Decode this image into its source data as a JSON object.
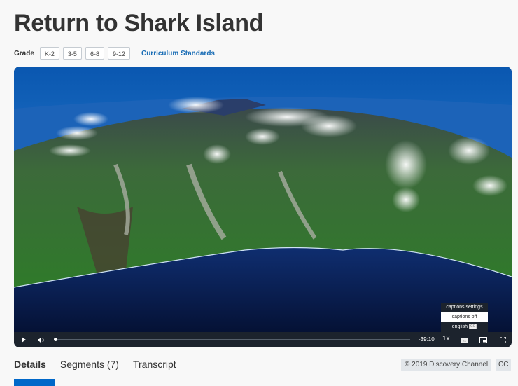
{
  "page": {
    "title": "Return to Shark Island",
    "grade_label": "Grade",
    "grades": [
      "K-2",
      "3-5",
      "6-8",
      "9-12"
    ],
    "curriculum_link": "Curriculum Standards"
  },
  "video": {
    "scene_description": "aerial view of volcanic island with clouds and deep blue ocean",
    "progress_fraction": 0.0,
    "time_remaining": "-39:10",
    "playback_speed": "1x",
    "captions_menu": {
      "header": "captions settings",
      "items": [
        "captions off",
        "english"
      ],
      "selected": "captions off",
      "cc_badge": "CC"
    },
    "icons": {
      "play": "play-icon",
      "volume": "volume-icon",
      "captions": "closed-captions-icon",
      "pip": "picture-in-picture-icon",
      "fullscreen": "fullscreen-icon"
    }
  },
  "tabs": [
    {
      "label": "Details",
      "active": true
    },
    {
      "label": "Segments (7)",
      "active": false
    },
    {
      "label": "Transcript",
      "active": false
    }
  ],
  "credit": "© 2019 Discovery Channel",
  "cc_tag": "CC",
  "colors": {
    "accent": "#0068c9",
    "link": "#1a6db5",
    "control_bar": "#1c232d"
  }
}
